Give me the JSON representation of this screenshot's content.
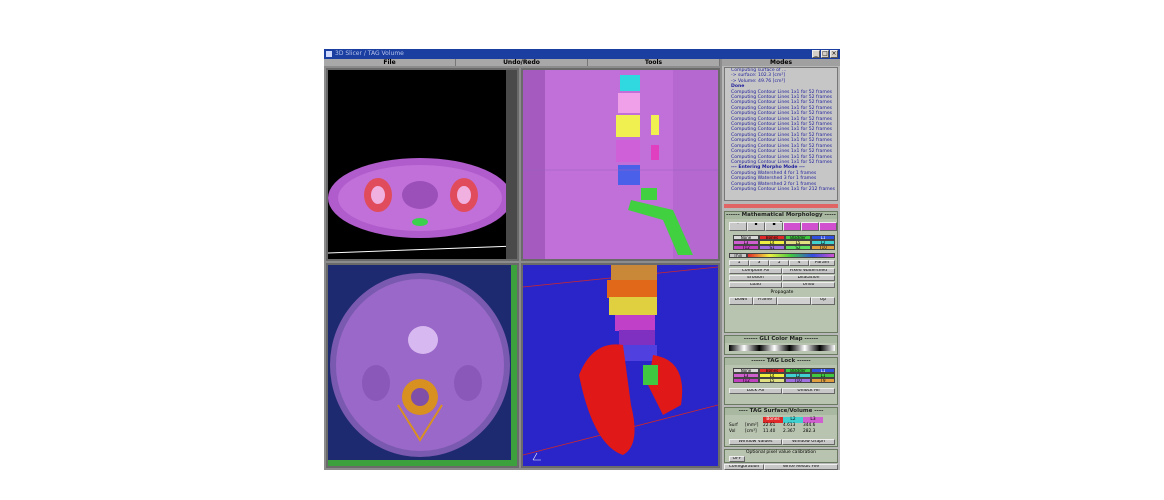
{
  "window": {
    "title": "3D Slicer / TAG Volume",
    "buttons": [
      "_",
      "□",
      "×"
    ]
  },
  "menubar": [
    {
      "label": "File"
    },
    {
      "label": "Undo/Redo"
    },
    {
      "label": "Tools"
    }
  ],
  "modes_title": "Modes",
  "log_lines": [
    "Computing surface of ...",
    "-> surface: 102.3 [cm²]",
    "-> Volume: 49.76 [cm³]",
    "Done",
    "Computing Contour Lines 1x1 for 52 frames",
    "Computing Contour Lines 1x1 for 52 frames",
    "Computing Contour Lines 1x1 for 52 frames",
    "Computing Contour Lines 1x1 for 52 frames",
    "Computing Contour Lines 1x1 for 52 frames",
    "Computing Contour Lines 1x1 for 52 frames",
    "Computing Contour Lines 1x1 for 52 frames",
    "Computing Contour Lines 1x1 for 52 frames",
    "Computing Contour Lines 1x1 for 52 frames",
    "Computing Contour Lines 1x1 for 52 frames",
    "Computing Contour Lines 1x1 for 52 frames",
    "Computing Contour Lines 1x1 for 52 frames",
    "Computing Contour Lines 1x1 for 52 frames",
    "Computing Contour Lines 1x1 for 52 frames",
    "--- Entering Morpho Mode ---",
    "Computing Watershed 4 for 1 frames",
    "Computing Watershed 3 for 1 frames",
    "Computing Watershed 2 for 1 frames",
    "Computing Contour Lines 1x1 for 212 frames"
  ],
  "morphology": {
    "title": "------ Mathematical Morphology ------",
    "tag_row1": [
      "None",
      "Bones",
      "Bladder",
      "L1"
    ],
    "tag_row2": [
      "L3",
      "L4",
      "L5",
      "L2"
    ],
    "tag_row3": [
      "T12",
      "S1",
      "S2",
      "T10"
    ],
    "thin_label": "Thin",
    "params": [
      "1",
      "3",
      "5",
      "4",
      "Param"
    ],
    "buttons": [
      "Compute All",
      "Fixed Watershed",
      "Erosion",
      "Dilatation",
      "Load",
      "Undo"
    ],
    "propagate": "Propagate",
    "down": "Down",
    "frame": "Frame",
    "up": "Up"
  },
  "colormap": {
    "title": "------ GLI Color Map ------"
  },
  "taglock": {
    "title": "------ TAG Lock ------",
    "row1": [
      "None",
      "Bones",
      "Bladder",
      "L1"
    ],
    "row2": [
      "L3",
      "L4",
      "L2",
      "L1"
    ],
    "row3": [
      "T12",
      "L5",
      "T10",
      "T9"
    ],
    "lock_all": "Lock All",
    "unlock_all": "Unlock All"
  },
  "surface": {
    "title": "---- TAG Surface/Volume ----",
    "headers": [
      "",
      "",
      "Bones",
      "L2",
      "L3"
    ],
    "row1": [
      "Surf",
      "[mm²]",
      "22.61",
      "4.613",
      "344.6"
    ],
    "row2": [
      "Vol",
      "[cm³]",
      "11.40",
      "2.367",
      "282.3"
    ],
    "window_values": "Window Values",
    "window_graph": "Window Graph"
  },
  "calibration": {
    "title": "Optional pixel value calibration",
    "toggle": "OFF"
  },
  "bottom": {
    "configuration": "Configuration",
    "write": "Write Result File"
  },
  "colors": {
    "titlebar": "#1a3fa0",
    "panel": "#b8b8b8",
    "viewport_bg": "#000000",
    "render_bg": "#2a25c8",
    "tissue": "#c070d8"
  }
}
